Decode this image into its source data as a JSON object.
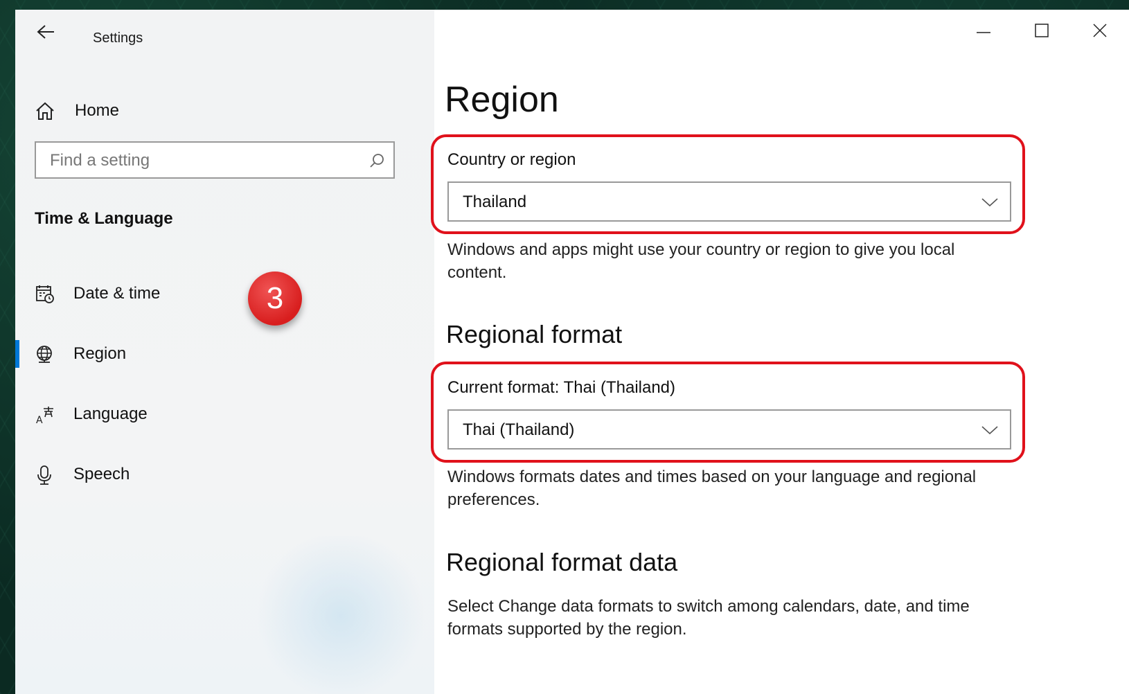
{
  "window": {
    "title": "Settings",
    "controls": {
      "minimize": "minimize",
      "maximize": "maximize",
      "close": "close"
    }
  },
  "sidebar": {
    "home_label": "Home",
    "search_placeholder": "Find a setting",
    "section_title": "Time & Language",
    "items": [
      {
        "label": "Date & time",
        "icon": "calendar-clock-icon",
        "active": false
      },
      {
        "label": "Region",
        "icon": "globe-icon",
        "active": true
      },
      {
        "label": "Language",
        "icon": "language-icon",
        "active": false
      },
      {
        "label": "Speech",
        "icon": "microphone-icon",
        "active": false
      }
    ],
    "step_badge": "3"
  },
  "main": {
    "title": "Region",
    "country": {
      "label": "Country or region",
      "selected": "Thailand",
      "description": "Windows and apps might use your country or region to give you local content."
    },
    "regional_format": {
      "heading": "Regional format",
      "label": "Current format: Thai (Thailand)",
      "selected": "Thai (Thailand)",
      "description": "Windows formats dates and times based on your language and regional preferences."
    },
    "regional_format_data": {
      "heading": "Regional format data",
      "description": "Select Change data formats to switch among calendars, date, and time formats supported by the region."
    }
  },
  "colors": {
    "accent": "#0078d7",
    "highlight": "#e0111b",
    "badge": "#d81e1e"
  }
}
